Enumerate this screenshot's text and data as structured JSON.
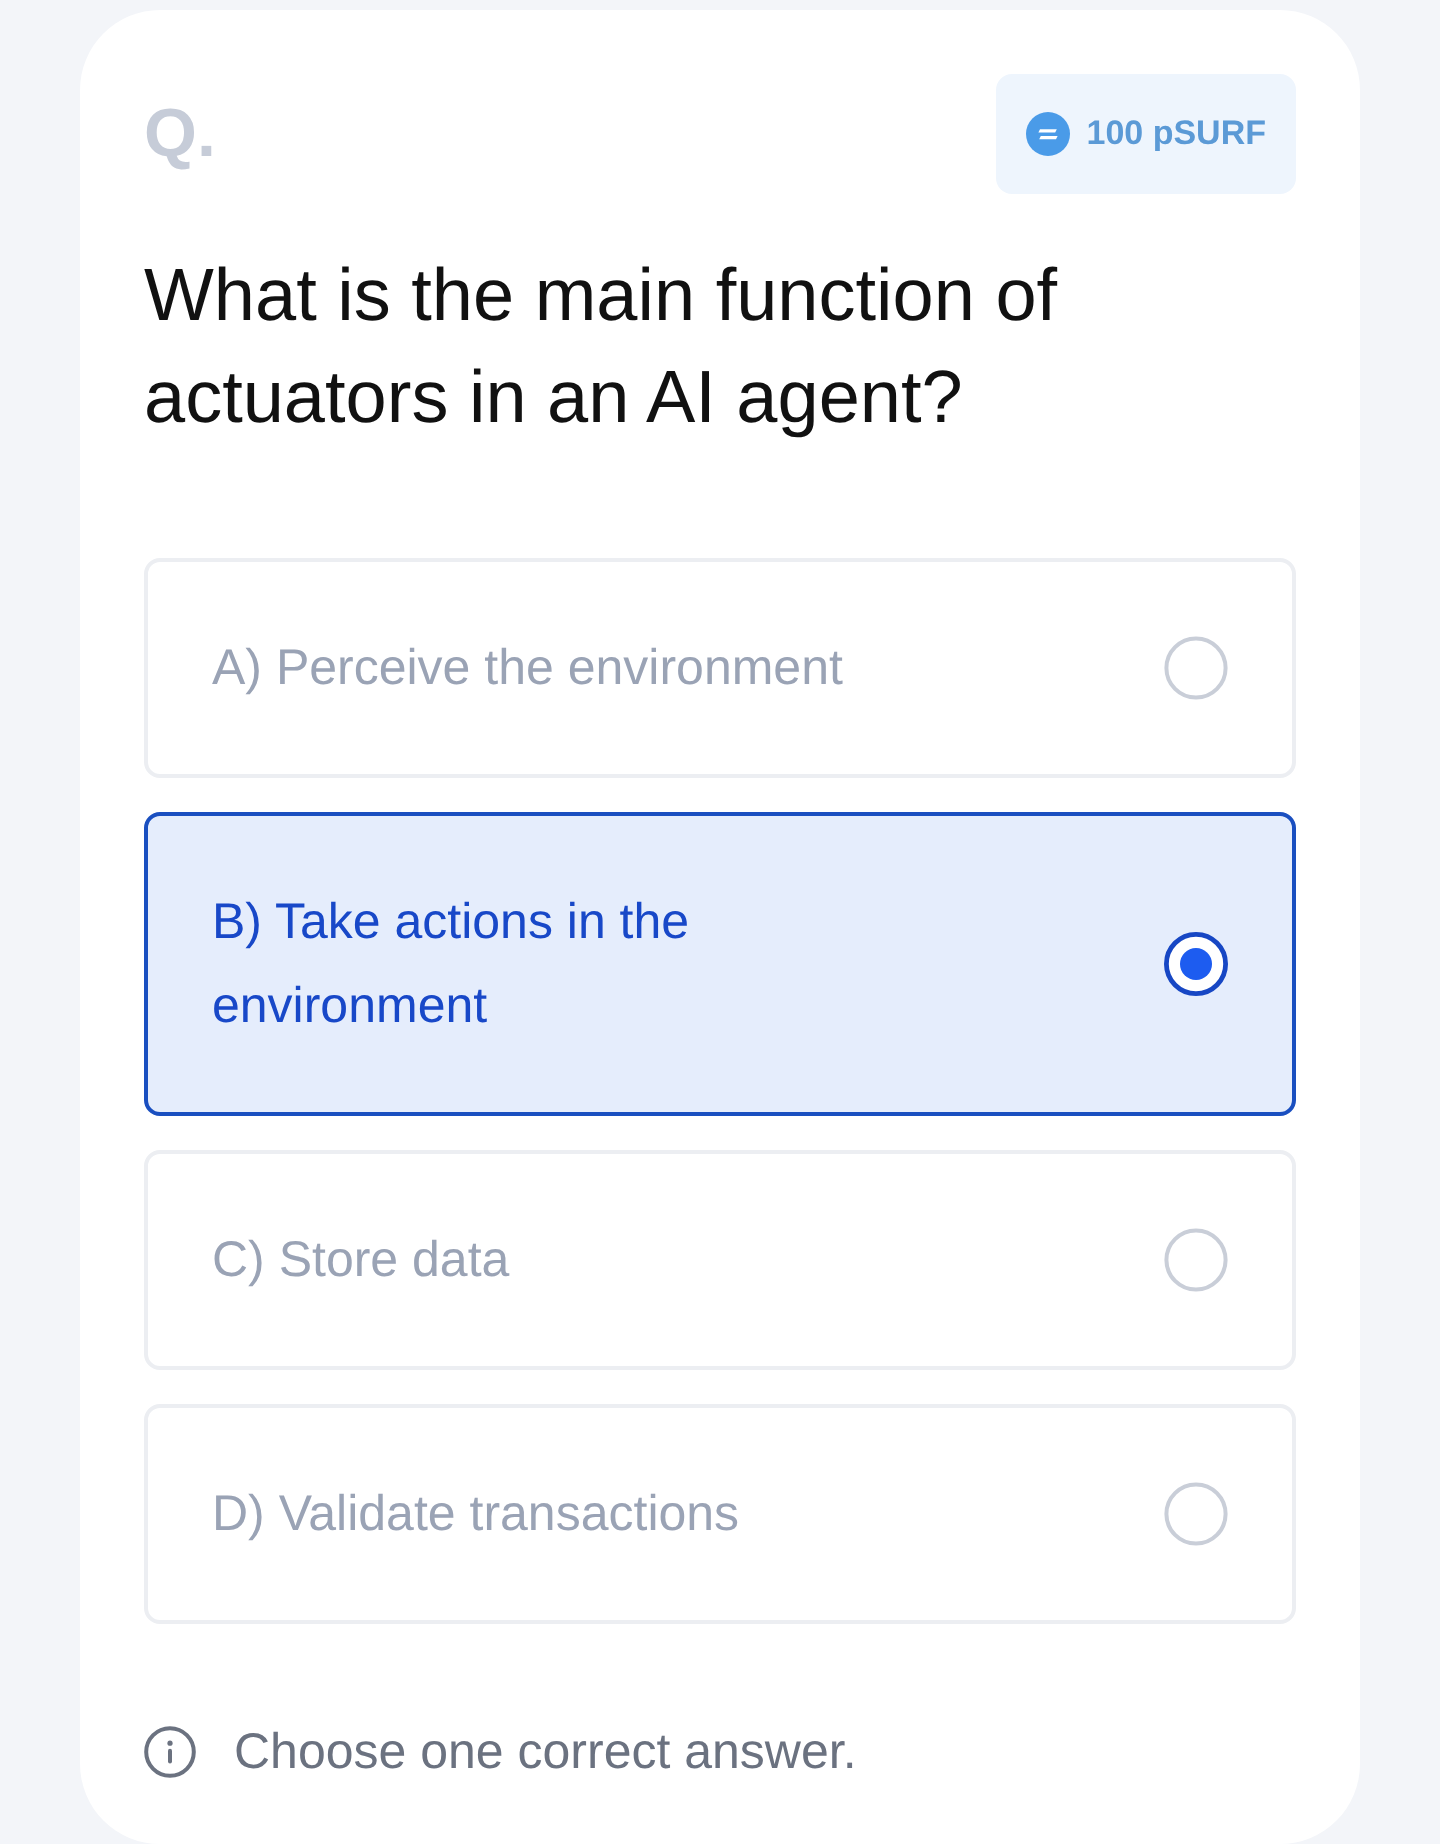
{
  "question_card": {
    "label": "Q.",
    "reward_badge": {
      "amount": "100 pSURF"
    },
    "question": "What is the main function of actuators in an AI agent?",
    "options": [
      {
        "text": "A) Perceive the environment",
        "selected": false
      },
      {
        "text": "B) Take actions in the environment",
        "selected": true
      },
      {
        "text": "C) Store data",
        "selected": false
      },
      {
        "text": "D) Validate transactions",
        "selected": false
      }
    ],
    "hint": "Choose one correct answer."
  }
}
